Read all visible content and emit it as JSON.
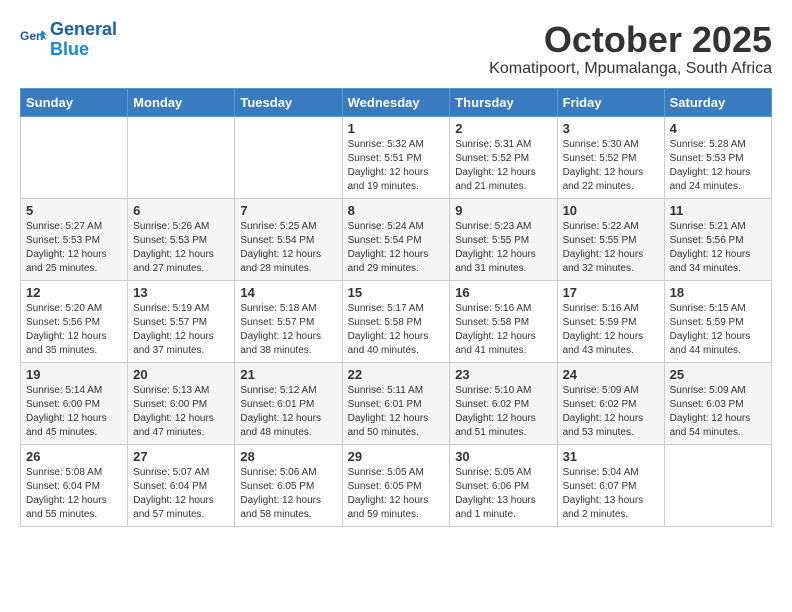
{
  "header": {
    "logo_line1": "General",
    "logo_line2": "Blue",
    "month": "October 2025",
    "location": "Komatipoort, Mpumalanga, South Africa"
  },
  "weekdays": [
    "Sunday",
    "Monday",
    "Tuesday",
    "Wednesday",
    "Thursday",
    "Friday",
    "Saturday"
  ],
  "weeks": [
    [
      {
        "day": "",
        "text": ""
      },
      {
        "day": "",
        "text": ""
      },
      {
        "day": "",
        "text": ""
      },
      {
        "day": "1",
        "text": "Sunrise: 5:32 AM\nSunset: 5:51 PM\nDaylight: 12 hours\nand 19 minutes."
      },
      {
        "day": "2",
        "text": "Sunrise: 5:31 AM\nSunset: 5:52 PM\nDaylight: 12 hours\nand 21 minutes."
      },
      {
        "day": "3",
        "text": "Sunrise: 5:30 AM\nSunset: 5:52 PM\nDaylight: 12 hours\nand 22 minutes."
      },
      {
        "day": "4",
        "text": "Sunrise: 5:28 AM\nSunset: 5:53 PM\nDaylight: 12 hours\nand 24 minutes."
      }
    ],
    [
      {
        "day": "5",
        "text": "Sunrise: 5:27 AM\nSunset: 5:53 PM\nDaylight: 12 hours\nand 25 minutes."
      },
      {
        "day": "6",
        "text": "Sunrise: 5:26 AM\nSunset: 5:53 PM\nDaylight: 12 hours\nand 27 minutes."
      },
      {
        "day": "7",
        "text": "Sunrise: 5:25 AM\nSunset: 5:54 PM\nDaylight: 12 hours\nand 28 minutes."
      },
      {
        "day": "8",
        "text": "Sunrise: 5:24 AM\nSunset: 5:54 PM\nDaylight: 12 hours\nand 29 minutes."
      },
      {
        "day": "9",
        "text": "Sunrise: 5:23 AM\nSunset: 5:55 PM\nDaylight: 12 hours\nand 31 minutes."
      },
      {
        "day": "10",
        "text": "Sunrise: 5:22 AM\nSunset: 5:55 PM\nDaylight: 12 hours\nand 32 minutes."
      },
      {
        "day": "11",
        "text": "Sunrise: 5:21 AM\nSunset: 5:56 PM\nDaylight: 12 hours\nand 34 minutes."
      }
    ],
    [
      {
        "day": "12",
        "text": "Sunrise: 5:20 AM\nSunset: 5:56 PM\nDaylight: 12 hours\nand 35 minutes."
      },
      {
        "day": "13",
        "text": "Sunrise: 5:19 AM\nSunset: 5:57 PM\nDaylight: 12 hours\nand 37 minutes."
      },
      {
        "day": "14",
        "text": "Sunrise: 5:18 AM\nSunset: 5:57 PM\nDaylight: 12 hours\nand 38 minutes."
      },
      {
        "day": "15",
        "text": "Sunrise: 5:17 AM\nSunset: 5:58 PM\nDaylight: 12 hours\nand 40 minutes."
      },
      {
        "day": "16",
        "text": "Sunrise: 5:16 AM\nSunset: 5:58 PM\nDaylight: 12 hours\nand 41 minutes."
      },
      {
        "day": "17",
        "text": "Sunrise: 5:16 AM\nSunset: 5:59 PM\nDaylight: 12 hours\nand 43 minutes."
      },
      {
        "day": "18",
        "text": "Sunrise: 5:15 AM\nSunset: 5:59 PM\nDaylight: 12 hours\nand 44 minutes."
      }
    ],
    [
      {
        "day": "19",
        "text": "Sunrise: 5:14 AM\nSunset: 6:00 PM\nDaylight: 12 hours\nand 45 minutes."
      },
      {
        "day": "20",
        "text": "Sunrise: 5:13 AM\nSunset: 6:00 PM\nDaylight: 12 hours\nand 47 minutes."
      },
      {
        "day": "21",
        "text": "Sunrise: 5:12 AM\nSunset: 6:01 PM\nDaylight: 12 hours\nand 48 minutes."
      },
      {
        "day": "22",
        "text": "Sunrise: 5:11 AM\nSunset: 6:01 PM\nDaylight: 12 hours\nand 50 minutes."
      },
      {
        "day": "23",
        "text": "Sunrise: 5:10 AM\nSunset: 6:02 PM\nDaylight: 12 hours\nand 51 minutes."
      },
      {
        "day": "24",
        "text": "Sunrise: 5:09 AM\nSunset: 6:02 PM\nDaylight: 12 hours\nand 53 minutes."
      },
      {
        "day": "25",
        "text": "Sunrise: 5:09 AM\nSunset: 6:03 PM\nDaylight: 12 hours\nand 54 minutes."
      }
    ],
    [
      {
        "day": "26",
        "text": "Sunrise: 5:08 AM\nSunset: 6:04 PM\nDaylight: 12 hours\nand 55 minutes."
      },
      {
        "day": "27",
        "text": "Sunrise: 5:07 AM\nSunset: 6:04 PM\nDaylight: 12 hours\nand 57 minutes."
      },
      {
        "day": "28",
        "text": "Sunrise: 5:06 AM\nSunset: 6:05 PM\nDaylight: 12 hours\nand 58 minutes."
      },
      {
        "day": "29",
        "text": "Sunrise: 5:05 AM\nSunset: 6:05 PM\nDaylight: 12 hours\nand 59 minutes."
      },
      {
        "day": "30",
        "text": "Sunrise: 5:05 AM\nSunset: 6:06 PM\nDaylight: 13 hours\nand 1 minute."
      },
      {
        "day": "31",
        "text": "Sunrise: 5:04 AM\nSunset: 6:07 PM\nDaylight: 13 hours\nand 2 minutes."
      },
      {
        "day": "",
        "text": ""
      }
    ]
  ]
}
